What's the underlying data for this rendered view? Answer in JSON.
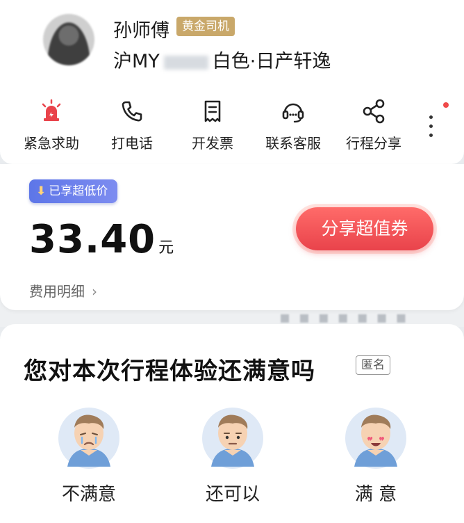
{
  "driver": {
    "name": "孙师傅",
    "badge": "黄金司机",
    "plate_prefix": "沪MY",
    "car_desc": "白色·日产轩逸"
  },
  "actions": [
    {
      "label": "紧急求助",
      "icon": "alarm-icon"
    },
    {
      "label": "打电话",
      "icon": "phone-icon"
    },
    {
      "label": "开发票",
      "icon": "invoice-icon"
    },
    {
      "label": "联系客服",
      "icon": "headset-icon"
    },
    {
      "label": "行程分享",
      "icon": "share-icon"
    }
  ],
  "fare": {
    "badge": "已享超低价",
    "amount": "33.40",
    "unit": "元",
    "detail_link": "费用明细",
    "share_button": "分享超值券"
  },
  "rating": {
    "title": "您对本次行程体验还满意吗",
    "anonymous_tag": "匿名",
    "options": [
      {
        "label": "不满意",
        "icon": "unsatisfied-face-icon"
      },
      {
        "label": "还可以",
        "icon": "neutral-face-icon"
      },
      {
        "label": "满 意",
        "icon": "satisfied-face-icon"
      }
    ]
  },
  "colors": {
    "accent_red": "#e9434b",
    "badge_blue": "#5d76e8",
    "gold_badge": "#c9a86a"
  }
}
